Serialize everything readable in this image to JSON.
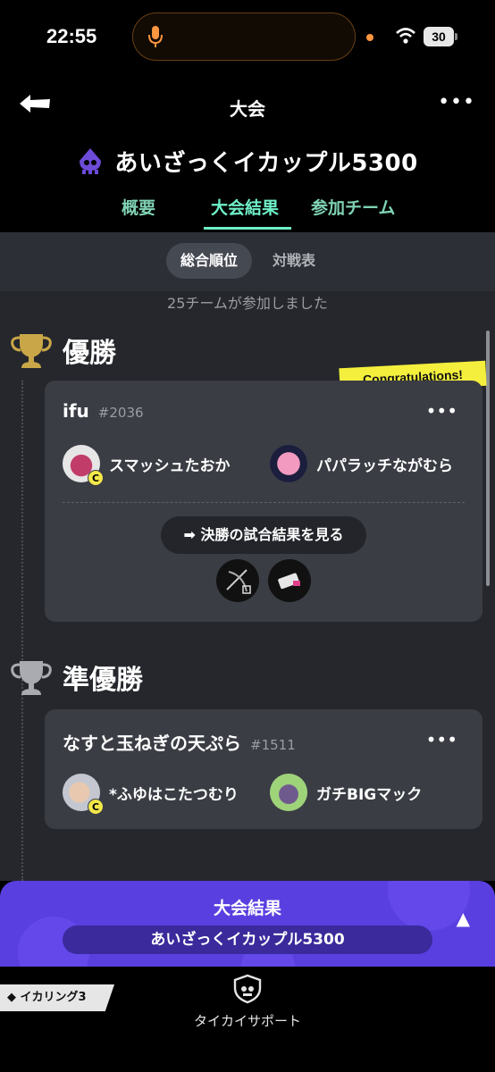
{
  "status_bar": {
    "time": "22:55",
    "battery": "30"
  },
  "header": {
    "title": "大会",
    "more_label": "•••"
  },
  "tournament": {
    "name": "あいざっくイカップル5300",
    "accent": "#6c4bd8"
  },
  "tabs": [
    {
      "label": "概要",
      "active": false
    },
    {
      "label": "大会結果",
      "active": true
    },
    {
      "label": "参加チーム",
      "active": false
    }
  ],
  "sub_tabs": [
    {
      "label": "総合順位",
      "active": true
    },
    {
      "label": "対戦表",
      "active": false
    }
  ],
  "participants_text": "25チームが参加しました",
  "congrats_label": "Congratulations!",
  "rankings": [
    {
      "rank_label": "優勝",
      "trophy": "gold-trophy-icon",
      "team_name": "ifu",
      "team_id": "#2036",
      "members": [
        {
          "name": "スマッシュたおか",
          "captain": true,
          "captain_mark": "C"
        },
        {
          "name": "パパラッチながむら",
          "captain": false
        }
      ],
      "final_button": "決勝の試合結果を見る"
    },
    {
      "rank_label": "準優勝",
      "trophy": "silver-trophy-icon",
      "team_name": "なすと玉ねぎの天ぷら",
      "team_id": "#1511",
      "members": [
        {
          "name": "*ふゆはこたつむり",
          "captain": true,
          "captain_mark": "C"
        },
        {
          "name": "ガチBIGマック",
          "captain": false
        }
      ]
    }
  ],
  "result_bar": {
    "title": "大会結果",
    "tournament_name": "あいざっくイカップル5300",
    "arrow": "▲"
  },
  "bottom_nav": {
    "ika_tab": "イカリング3",
    "support_label": "タイカイサポート"
  },
  "colors": {
    "tab_active": "#6ff0c8",
    "result_bar": "#5a3fe0",
    "congrats": "#f3ef3c"
  }
}
